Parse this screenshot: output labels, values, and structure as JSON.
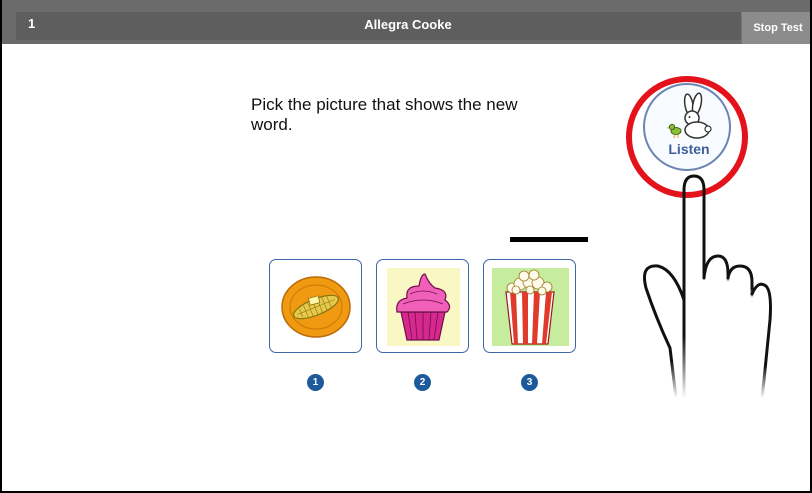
{
  "header": {
    "question_number": "1",
    "student_name": "Allegra Cooke",
    "stop_label": "Stop Test"
  },
  "prompt": {
    "text": "Pick the picture that shows the new word."
  },
  "listen": {
    "label": "Listen",
    "icon": "rabbit-bird-icon",
    "highlight_color": "#e4131b"
  },
  "choices": [
    {
      "number": "1",
      "image": "corn-on-plate"
    },
    {
      "number": "2",
      "image": "cupcake"
    },
    {
      "number": "3",
      "image": "popcorn"
    }
  ],
  "colors": {
    "header_bg": "#6b6b6b",
    "card_border": "#3f67a8",
    "number_badge": "#1d5a9c"
  }
}
